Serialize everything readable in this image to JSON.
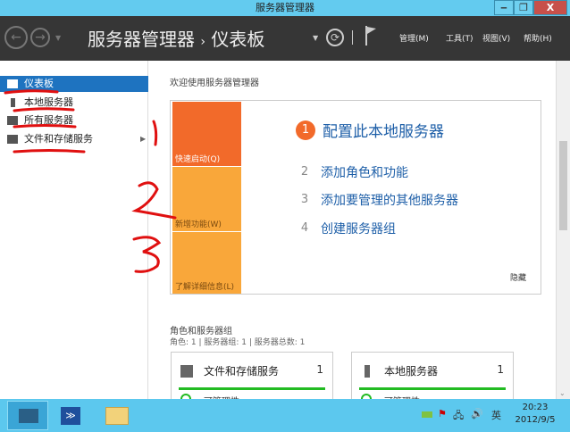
{
  "window": {
    "title": "服务器管理器",
    "minimize": "‒",
    "restore": "❐",
    "close": "X"
  },
  "header": {
    "back": "←",
    "forward": "→",
    "crumb_app": "服务器管理器",
    "crumb_sep": "›",
    "crumb_page": "仪表板",
    "refresh": "⟳",
    "menus": [
      "管理(M)",
      "工具(T)",
      "视图(V)",
      "帮助(H)"
    ]
  },
  "sidebar": {
    "items": [
      {
        "label": "仪表板",
        "selected": true
      },
      {
        "label": "本地服务器"
      },
      {
        "label": "所有服务器"
      },
      {
        "label": "文件和存储服务",
        "has_submenu": true
      }
    ]
  },
  "welcome": {
    "title": "欢迎使用服务器管理器",
    "tiles": [
      "快速启动(Q)",
      "新增功能(W)",
      "了解详细信息(L)"
    ],
    "steps": [
      {
        "n": "1",
        "label": "配置此本地服务器"
      },
      {
        "n": "2",
        "label": "添加角色和功能"
      },
      {
        "n": "3",
        "label": "添加要管理的其他服务器"
      },
      {
        "n": "4",
        "label": "创建服务器组"
      }
    ],
    "hide": "隐藏"
  },
  "roles": {
    "title": "角色和服务器组",
    "summary": "角色: 1 | 服务器组: 1 | 服务器总数: 1",
    "cards": [
      {
        "title": "文件和存储服务",
        "count": "1",
        "status": "可管理性"
      },
      {
        "title": "本地服务器",
        "count": "1",
        "status": "可管理性"
      }
    ]
  },
  "taskbar": {
    "ime": "英",
    "time": "20:23",
    "date": "2012/9/5"
  },
  "colors": {
    "accent": "#1e73c0",
    "tile_primary": "#f26a2a",
    "tile_secondary": "#f9a73a",
    "annotation": "#e01010",
    "status_ok": "#22bb22"
  }
}
